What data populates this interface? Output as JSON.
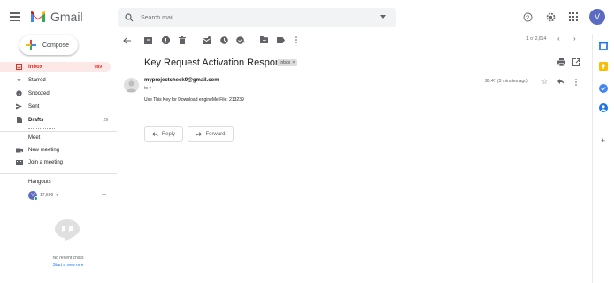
{
  "header": {
    "app_name": "Gmail",
    "search_placeholder": "Search mail",
    "avatar_letter": "V"
  },
  "sidebar": {
    "compose_label": "Compose",
    "items": [
      {
        "label": "Inbox",
        "count": "989"
      },
      {
        "label": "Starred",
        "count": ""
      },
      {
        "label": "Snoozed",
        "count": ""
      },
      {
        "label": "Sent",
        "count": ""
      },
      {
        "label": "Drafts",
        "count": "29"
      }
    ],
    "meet": {
      "title": "Meet",
      "new_meeting": "New meeting",
      "join_meeting": "Join a meeting"
    },
    "hangouts": {
      "title": "Hangouts",
      "user_name": "17,599",
      "avatar_letter": "V",
      "no_recent": "No recent chats",
      "start_new": "Start a new one"
    }
  },
  "toolbar": {
    "pagination": "1 of 2,614"
  },
  "message": {
    "subject": "Key Request Activation Response",
    "label": "Inbox",
    "sender": "myprojectcheck9@gmail.com",
    "to": "to",
    "time": "20:47 (3 minutes ago)",
    "body": "Use This Key for Download engineMe File: 213239",
    "reply_label": "Reply",
    "forward_label": "Forward"
  },
  "colors": {
    "accent_red": "#d93025",
    "inbox_bg": "#fce8e6",
    "link_blue": "#1a73e8",
    "avatar": "#5c6bc0"
  }
}
